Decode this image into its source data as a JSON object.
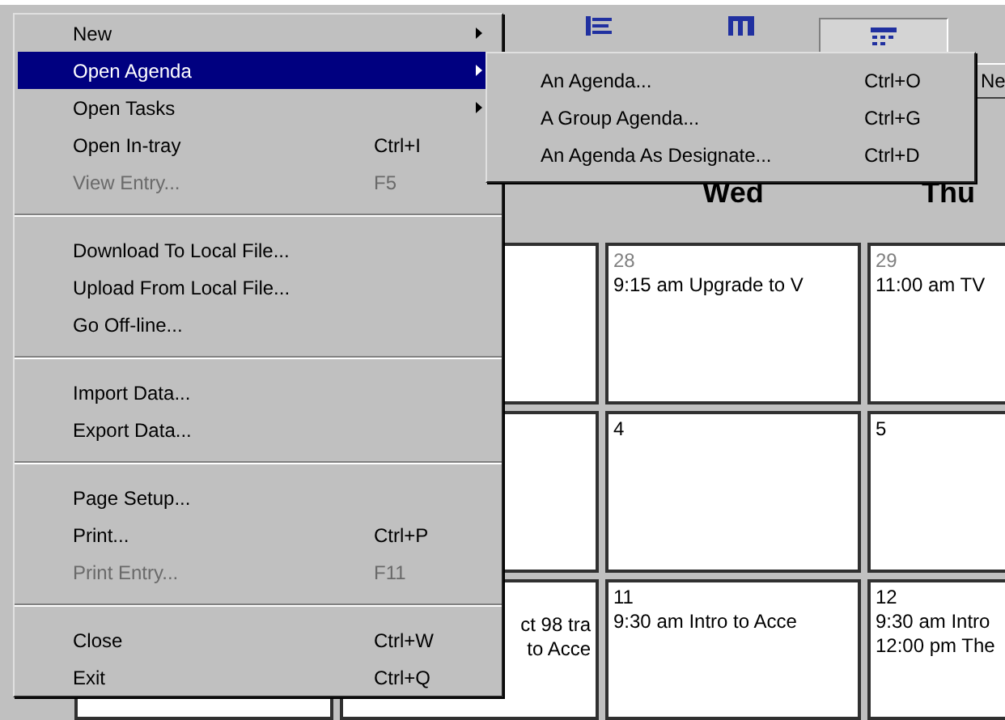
{
  "toolbar": {
    "buttons": [
      {
        "selected": false
      },
      {
        "selected": false
      },
      {
        "selected": true
      }
    ],
    "side_button": {
      "label": "Ne"
    }
  },
  "calendar": {
    "columns": [
      {
        "label": "Wed"
      },
      {
        "label": "Thu"
      }
    ],
    "weeks": [
      {
        "cells": [
          {
            "date": "28",
            "other_month": true,
            "events": [
              "9:15 am Upgrade to V"
            ]
          },
          {
            "date": "29",
            "other_month": true,
            "events": [
              "11:00 am TV"
            ]
          }
        ]
      },
      {
        "cells": [
          {
            "date": "4",
            "other_month": false
          },
          {
            "date": "5",
            "other_month": false
          }
        ]
      },
      {
        "partial_events": [
          "ct 98 tra",
          "to Acce"
        ],
        "cells": [
          {
            "date": "11",
            "other_month": false,
            "events": [
              "9:30 am Intro to Acce"
            ]
          },
          {
            "date": "12",
            "other_month": false,
            "events": [
              "9:30 am Intro",
              "12:00 pm The"
            ]
          }
        ]
      }
    ]
  },
  "menu": {
    "items": [
      {
        "kind": "item",
        "label": "New",
        "submenu": true,
        "disabled": false,
        "selected": false
      },
      {
        "kind": "item",
        "label": "Open Agenda",
        "submenu": true,
        "disabled": false,
        "selected": true
      },
      {
        "kind": "item",
        "label": "Open Tasks",
        "submenu": true,
        "disabled": false,
        "selected": false
      },
      {
        "kind": "item",
        "label": "Open In-tray",
        "shortcut": "Ctrl+I",
        "submenu": false,
        "disabled": false,
        "selected": false
      },
      {
        "kind": "item",
        "label": "View Entry...",
        "shortcut": "F5",
        "submenu": false,
        "disabled": true,
        "selected": false
      },
      {
        "kind": "separator"
      },
      {
        "kind": "item",
        "label": "Download To Local File...",
        "submenu": false,
        "disabled": false,
        "selected": false
      },
      {
        "kind": "item",
        "label": "Upload From Local File...",
        "submenu": false,
        "disabled": false,
        "selected": false
      },
      {
        "kind": "item",
        "label": "Go Off-line...",
        "submenu": false,
        "disabled": false,
        "selected": false
      },
      {
        "kind": "separator"
      },
      {
        "kind": "item",
        "label": "Import Data...",
        "submenu": false,
        "disabled": false,
        "selected": false
      },
      {
        "kind": "item",
        "label": "Export Data...",
        "submenu": false,
        "disabled": false,
        "selected": false
      },
      {
        "kind": "separator"
      },
      {
        "kind": "item",
        "label": "Page Setup...",
        "submenu": false,
        "disabled": false,
        "selected": false
      },
      {
        "kind": "item",
        "label": "Print...",
        "shortcut": "Ctrl+P",
        "submenu": false,
        "disabled": false,
        "selected": false
      },
      {
        "kind": "item",
        "label": "Print Entry...",
        "shortcut": "F11",
        "submenu": false,
        "disabled": true,
        "selected": false
      },
      {
        "kind": "separator"
      },
      {
        "kind": "item",
        "label": "Close",
        "shortcut": "Ctrl+W",
        "submenu": false,
        "disabled": false,
        "selected": false
      },
      {
        "kind": "item",
        "label": "Exit",
        "shortcut": "Ctrl+Q",
        "submenu": false,
        "disabled": false,
        "selected": false
      }
    ]
  },
  "submenu": {
    "items": [
      {
        "label": "An Agenda...",
        "shortcut": "Ctrl+O"
      },
      {
        "label": "A Group Agenda...",
        "shortcut": "Ctrl+G"
      },
      {
        "label": "An Agenda As Designate...",
        "shortcut": "Ctrl+D"
      }
    ]
  }
}
